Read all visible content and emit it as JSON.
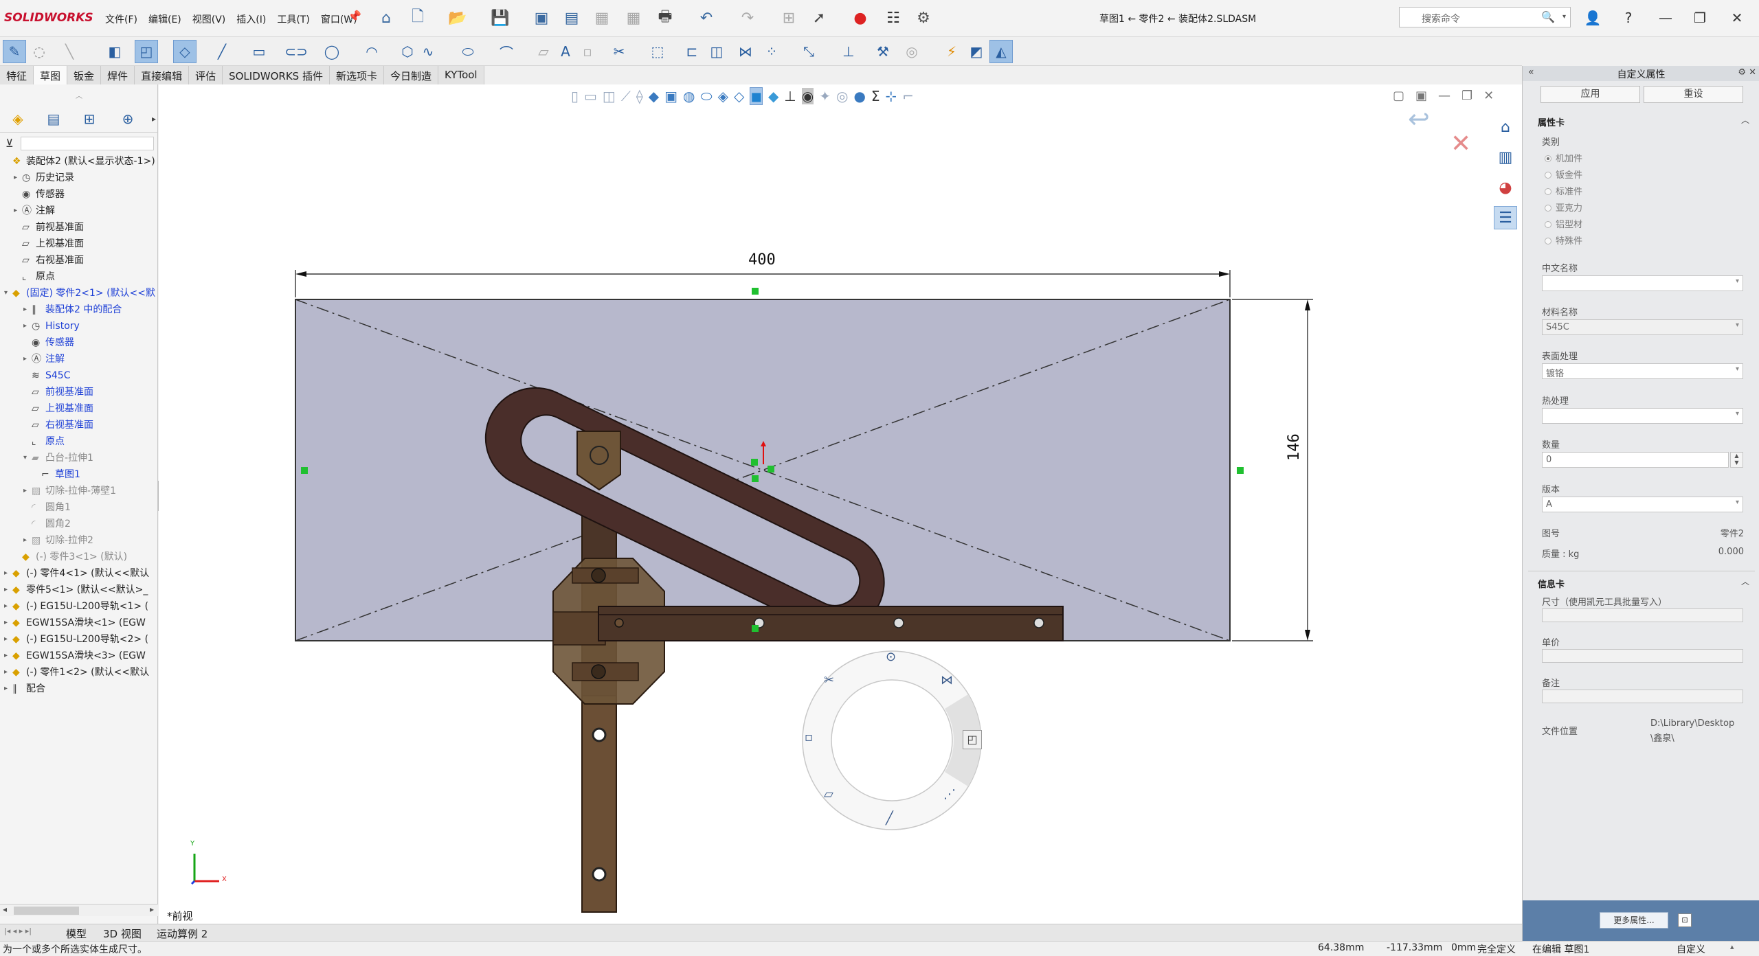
{
  "app": {
    "logo": "SOLIDWORKS",
    "menus": [
      "文件(F)",
      "编辑(E)",
      "视图(V)",
      "插入(I)",
      "工具(T)",
      "窗口(W)"
    ],
    "doc_title": "草图1 ← 零件2 ← 装配体2.SLDASM",
    "search_placeholder": "搜索命令"
  },
  "tabs": [
    "特征",
    "草图",
    "钣金",
    "焊件",
    "直接编辑",
    "评估",
    "SOLIDWORKS 插件",
    "新选项卡",
    "今日制造",
    "KYTool"
  ],
  "active_tab": "草图",
  "tree": [
    {
      "label": "装配体2  (默认<显示状态-1>)",
      "style": "normal",
      "indent": 0,
      "icon": "assembly-icon",
      "expand": ""
    },
    {
      "label": "历史记录",
      "style": "normal",
      "indent": 1,
      "icon": "history-icon",
      "expand": "▸"
    },
    {
      "label": "传感器",
      "style": "normal",
      "indent": 1,
      "icon": "sensor-icon",
      "expand": ""
    },
    {
      "label": "注解",
      "style": "normal",
      "indent": 1,
      "icon": "annotation-icon",
      "expand": "▸"
    },
    {
      "label": "前视基准面",
      "style": "normal",
      "indent": 1,
      "icon": "plane-icon",
      "expand": ""
    },
    {
      "label": "上视基准面",
      "style": "normal",
      "indent": 1,
      "icon": "plane-icon",
      "expand": ""
    },
    {
      "label": "右视基准面",
      "style": "normal",
      "indent": 1,
      "icon": "plane-icon",
      "expand": ""
    },
    {
      "label": "原点",
      "style": "normal",
      "indent": 1,
      "icon": "origin-icon",
      "expand": ""
    },
    {
      "label": "(固定) 零件2<1> (默认<<默",
      "style": "blue",
      "indent": 0,
      "icon": "part-icon",
      "expand": "▾"
    },
    {
      "label": "装配体2 中的配合",
      "style": "blue",
      "indent": 2,
      "icon": "mates-icon",
      "expand": "▸"
    },
    {
      "label": "History",
      "style": "blue",
      "indent": 2,
      "icon": "history-icon",
      "expand": "▸"
    },
    {
      "label": "传感器",
      "style": "blue",
      "indent": 2,
      "icon": "sensor-icon",
      "expand": ""
    },
    {
      "label": "注解",
      "style": "blue",
      "indent": 2,
      "icon": "annotation-icon",
      "expand": "▸"
    },
    {
      "label": "S45C",
      "style": "blue",
      "indent": 2,
      "icon": "material-icon",
      "expand": ""
    },
    {
      "label": "前视基准面",
      "style": "blue",
      "indent": 2,
      "icon": "plane-icon",
      "expand": ""
    },
    {
      "label": "上视基准面",
      "style": "blue",
      "indent": 2,
      "icon": "plane-icon",
      "expand": ""
    },
    {
      "label": "右视基准面",
      "style": "blue",
      "indent": 2,
      "icon": "plane-icon",
      "expand": ""
    },
    {
      "label": "原点",
      "style": "blue",
      "indent": 2,
      "icon": "origin-icon",
      "expand": ""
    },
    {
      "label": "凸台-拉伸1",
      "style": "gray",
      "indent": 2,
      "icon": "extrude-icon",
      "expand": "▾"
    },
    {
      "label": "草图1",
      "style": "blue",
      "indent": 3,
      "icon": "sketch-icon",
      "expand": ""
    },
    {
      "label": "切除-拉伸-薄壁1",
      "style": "gray",
      "indent": 2,
      "icon": "cut-icon",
      "expand": "▸"
    },
    {
      "label": "圆角1",
      "style": "gray",
      "indent": 2,
      "icon": "fillet-icon",
      "expand": ""
    },
    {
      "label": "圆角2",
      "style": "gray",
      "indent": 2,
      "icon": "fillet-icon",
      "expand": ""
    },
    {
      "label": "切除-拉伸2",
      "style": "gray",
      "indent": 2,
      "icon": "cut-icon",
      "expand": "▸"
    },
    {
      "label": "(-) 零件3<1> (默认)",
      "style": "gray",
      "indent": 1,
      "icon": "part-icon",
      "expand": ""
    },
    {
      "label": "(-) 零件4<1> (默认<<默认",
      "style": "normal",
      "indent": 0,
      "icon": "part-icon",
      "expand": "▸"
    },
    {
      "label": "零件5<1> (默认<<默认>_",
      "style": "normal",
      "indent": 0,
      "icon": "part-icon",
      "expand": "▸"
    },
    {
      "label": "(-) EG15U-L200导轨<1> (",
      "style": "normal",
      "indent": 0,
      "icon": "part-icon",
      "expand": "▸"
    },
    {
      "label": "EGW15SA滑块<1> (EGW",
      "style": "normal",
      "indent": 0,
      "icon": "part-icon",
      "expand": "▸"
    },
    {
      "label": "(-) EG15U-L200导轨<2> (",
      "style": "normal",
      "indent": 0,
      "icon": "part-icon",
      "expand": "▸"
    },
    {
      "label": "EGW15SA滑块<3> (EGW",
      "style": "normal",
      "indent": 0,
      "icon": "part-icon",
      "expand": "▸"
    },
    {
      "label": "(-) 零件1<2> (默认<<默认",
      "style": "normal",
      "indent": 0,
      "icon": "part-icon",
      "expand": "▸"
    },
    {
      "label": "配合",
      "style": "normal",
      "indent": 0,
      "icon": "mates-icon",
      "expand": "▸"
    }
  ],
  "viewport": {
    "dim_width": "400",
    "dim_height": "146",
    "view_name": "*前视",
    "triad_x": "X",
    "triad_y": "Y"
  },
  "bottom_tabs": [
    "模型",
    "3D 视图",
    "运动算例 2"
  ],
  "status": {
    "message": "为一个或多个所选实体生成尺寸。",
    "x": "64.38mm",
    "y": "-117.33mm",
    "z": "0mm",
    "state": "完全定义",
    "edit": "在编辑 草图1",
    "custom": "自定义"
  },
  "rightpane": {
    "title": "自定义属性",
    "apply": "应用",
    "reset": "重设",
    "section1": "属性卡",
    "category_label": "类别",
    "categories": [
      "机加件",
      "钣金件",
      "标准件",
      "亚克力",
      "铝型材",
      "特殊件"
    ],
    "selected_category": "机加件",
    "cn_name_label": "中文名称",
    "cn_name_value": "",
    "material_label": "材料名称",
    "material_value": "S45C",
    "surface_label": "表面处理",
    "surface_value": "镀铬",
    "heat_label": "热处理",
    "heat_value": "",
    "qty_label": "数量",
    "qty_value": "0",
    "version_label": "版本",
    "version_value": "A",
    "drawing_no_label": "图号",
    "drawing_no_value": "零件2",
    "mass_label": "质量 : kg",
    "mass_value": "0.000",
    "section2": "信息卡",
    "size_label": "尺寸（使用凯元工具批量写入）",
    "unit_label": "单价",
    "note_label": "备注",
    "path_label": "文件位置",
    "path_value_1": "D:\\Library\\Desktop",
    "path_value_2": "\\鑫泉\\",
    "more_label": "更多属性..."
  },
  "colors": {
    "sketch_fill": "#b7b8cc",
    "part_brown": "#4a2e2a",
    "bronze": "#6e5538",
    "accent_blue": "#2a5fa0",
    "link_blue": "#1d3fd6"
  }
}
